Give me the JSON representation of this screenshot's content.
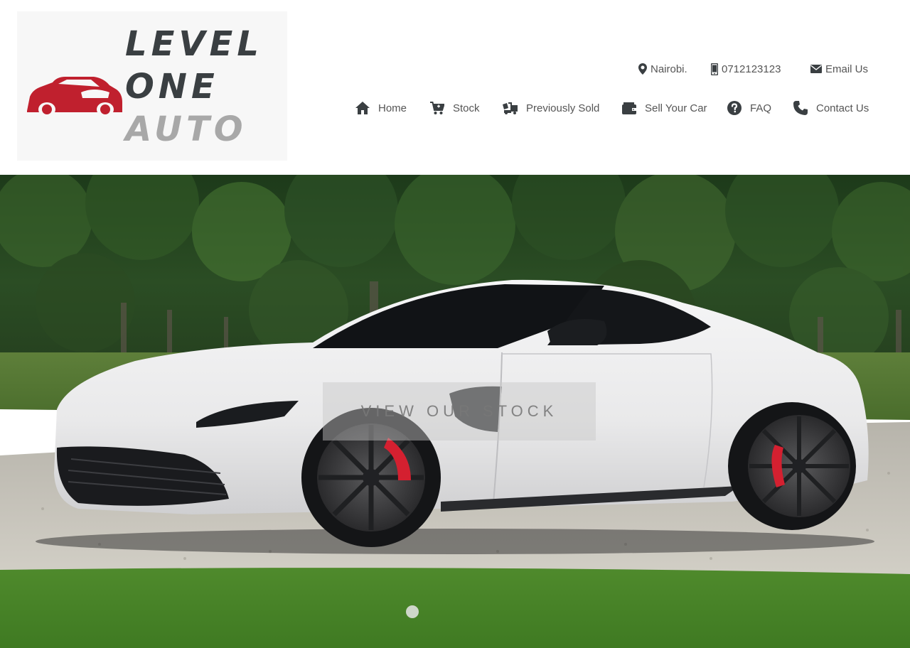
{
  "brand": {
    "line1": "LEVEL",
    "line2": "ONE",
    "line3": "AUTO",
    "primary_color": "#c0202e",
    "dark_color": "#3a3f42",
    "light_color": "#a8a8a8"
  },
  "contact": {
    "location": {
      "label": "Nairobi.",
      "icon": "map-marker-icon"
    },
    "phone": {
      "label": "0712123123",
      "icon": "mobile-phone-icon"
    },
    "email": {
      "label": "Email Us",
      "icon": "envelope-icon"
    }
  },
  "nav": {
    "items": [
      {
        "label": "Home",
        "icon": "home-icon"
      },
      {
        "label": "Stock",
        "icon": "cart-icon"
      },
      {
        "label": "Previously Sold",
        "icon": "truck-icon"
      },
      {
        "label": "Sell Your Car",
        "icon": "wallet-icon"
      },
      {
        "label": "FAQ",
        "icon": "question-circle-icon"
      },
      {
        "label": "Contact Us",
        "icon": "phone-icon"
      }
    ]
  },
  "hero": {
    "cta_label": "VIEW OUR STOCK",
    "slides_count": 1,
    "active_slide": 1,
    "car_color": "#eeeeef",
    "caliper_color": "#d42030"
  }
}
